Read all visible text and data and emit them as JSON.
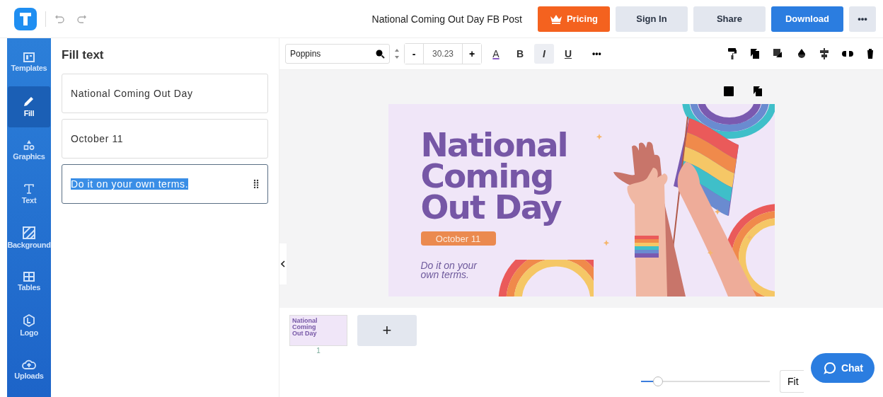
{
  "header": {
    "document_title": "National Coming Out Day FB Post",
    "buttons": [
      {
        "label": "Pricing",
        "kind": "pricing"
      },
      {
        "label": "Sign In",
        "kind": "plain"
      },
      {
        "label": "Share",
        "kind": "plain"
      },
      {
        "label": "Download",
        "kind": "primary"
      },
      {
        "label": "•••",
        "kind": "more"
      }
    ]
  },
  "sidebar": {
    "items": [
      {
        "label": "Templates",
        "selected": false
      },
      {
        "label": "Fill",
        "selected": true
      },
      {
        "label": "Graphics",
        "selected": false
      },
      {
        "label": "Text",
        "selected": false
      },
      {
        "label": "Background",
        "selected": false
      },
      {
        "label": "Tables",
        "selected": false
      },
      {
        "label": "Logo",
        "selected": false
      },
      {
        "label": "Uploads",
        "selected": false
      }
    ]
  },
  "fill_panel": {
    "title": "Fill text",
    "fields": [
      {
        "value": "National Coming Out Day",
        "selected": false
      },
      {
        "value": "October 11",
        "selected": false
      },
      {
        "value": "Do it on your own terms.",
        "selected": true
      }
    ]
  },
  "toolbar": {
    "font": "Poppins",
    "size": "30.23",
    "minus": "-",
    "plus": "+",
    "more": "•••",
    "format": [
      {
        "kind": "color",
        "label": "A",
        "active": false
      },
      {
        "kind": "bold",
        "label": "B",
        "active": false
      },
      {
        "kind": "italic",
        "label": "I",
        "active": true
      },
      {
        "kind": "underline",
        "label": "U",
        "active": false
      }
    ]
  },
  "design": {
    "title": "National Coming Out Day",
    "date": "October 11",
    "tagline": "Do it on your own terms."
  },
  "pages": {
    "thumbnail_title": "National Coming Out Day",
    "page_number": "1",
    "add": "+"
  },
  "zoom": {
    "level": 0.13,
    "fit": "Fit"
  },
  "chat": {
    "label": "Chat"
  }
}
